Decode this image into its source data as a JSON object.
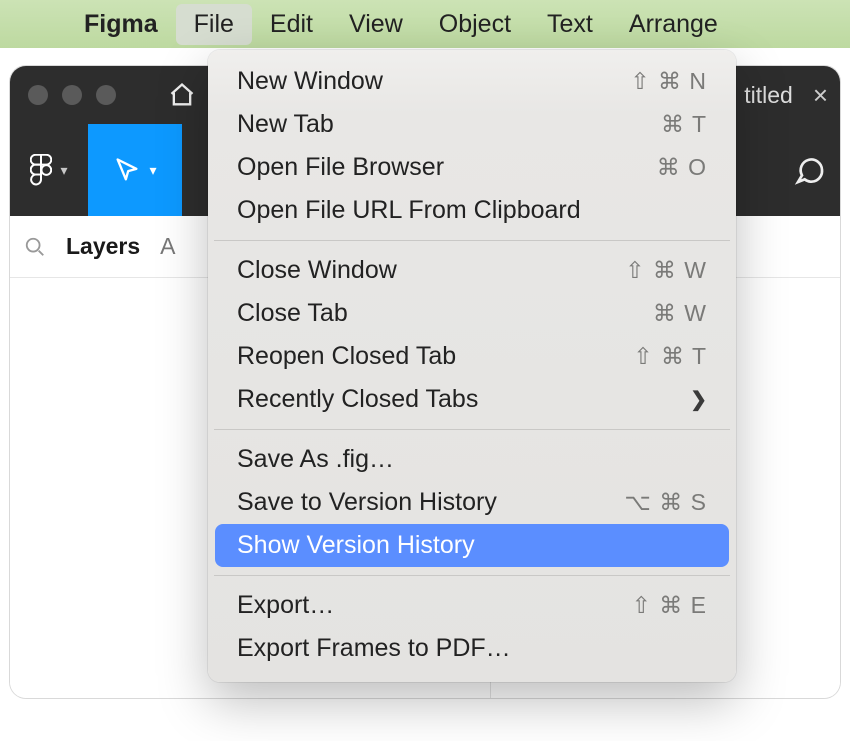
{
  "menubar": {
    "app": "Figma",
    "items": [
      "File",
      "Edit",
      "View",
      "Object",
      "Text",
      "Arrange"
    ],
    "open_index": 0
  },
  "window": {
    "tab_title": "titled",
    "close_glyph": "×"
  },
  "sidebar": {
    "tabs": [
      "Layers",
      "A"
    ]
  },
  "dropdown": {
    "groups": [
      [
        {
          "label": "New Window",
          "shortcut": "⇧ ⌘ N"
        },
        {
          "label": "New Tab",
          "shortcut": "⌘ T"
        },
        {
          "label": "Open File Browser",
          "shortcut": "⌘ O"
        },
        {
          "label": "Open File URL From Clipboard",
          "shortcut": ""
        }
      ],
      [
        {
          "label": "Close Window",
          "shortcut": "⇧ ⌘ W"
        },
        {
          "label": "Close Tab",
          "shortcut": "⌘ W"
        },
        {
          "label": "Reopen Closed Tab",
          "shortcut": "⇧ ⌘ T"
        },
        {
          "label": "Recently Closed Tabs",
          "shortcut": "",
          "submenu": true
        }
      ],
      [
        {
          "label": "Save As .fig…",
          "shortcut": ""
        },
        {
          "label": "Save to Version History",
          "shortcut": "⌥ ⌘ S"
        },
        {
          "label": "Show Version History",
          "shortcut": "",
          "highlight": true
        }
      ],
      [
        {
          "label": "Export…",
          "shortcut": "⇧ ⌘ E"
        },
        {
          "label": "Export Frames to PDF…",
          "shortcut": ""
        }
      ]
    ]
  }
}
